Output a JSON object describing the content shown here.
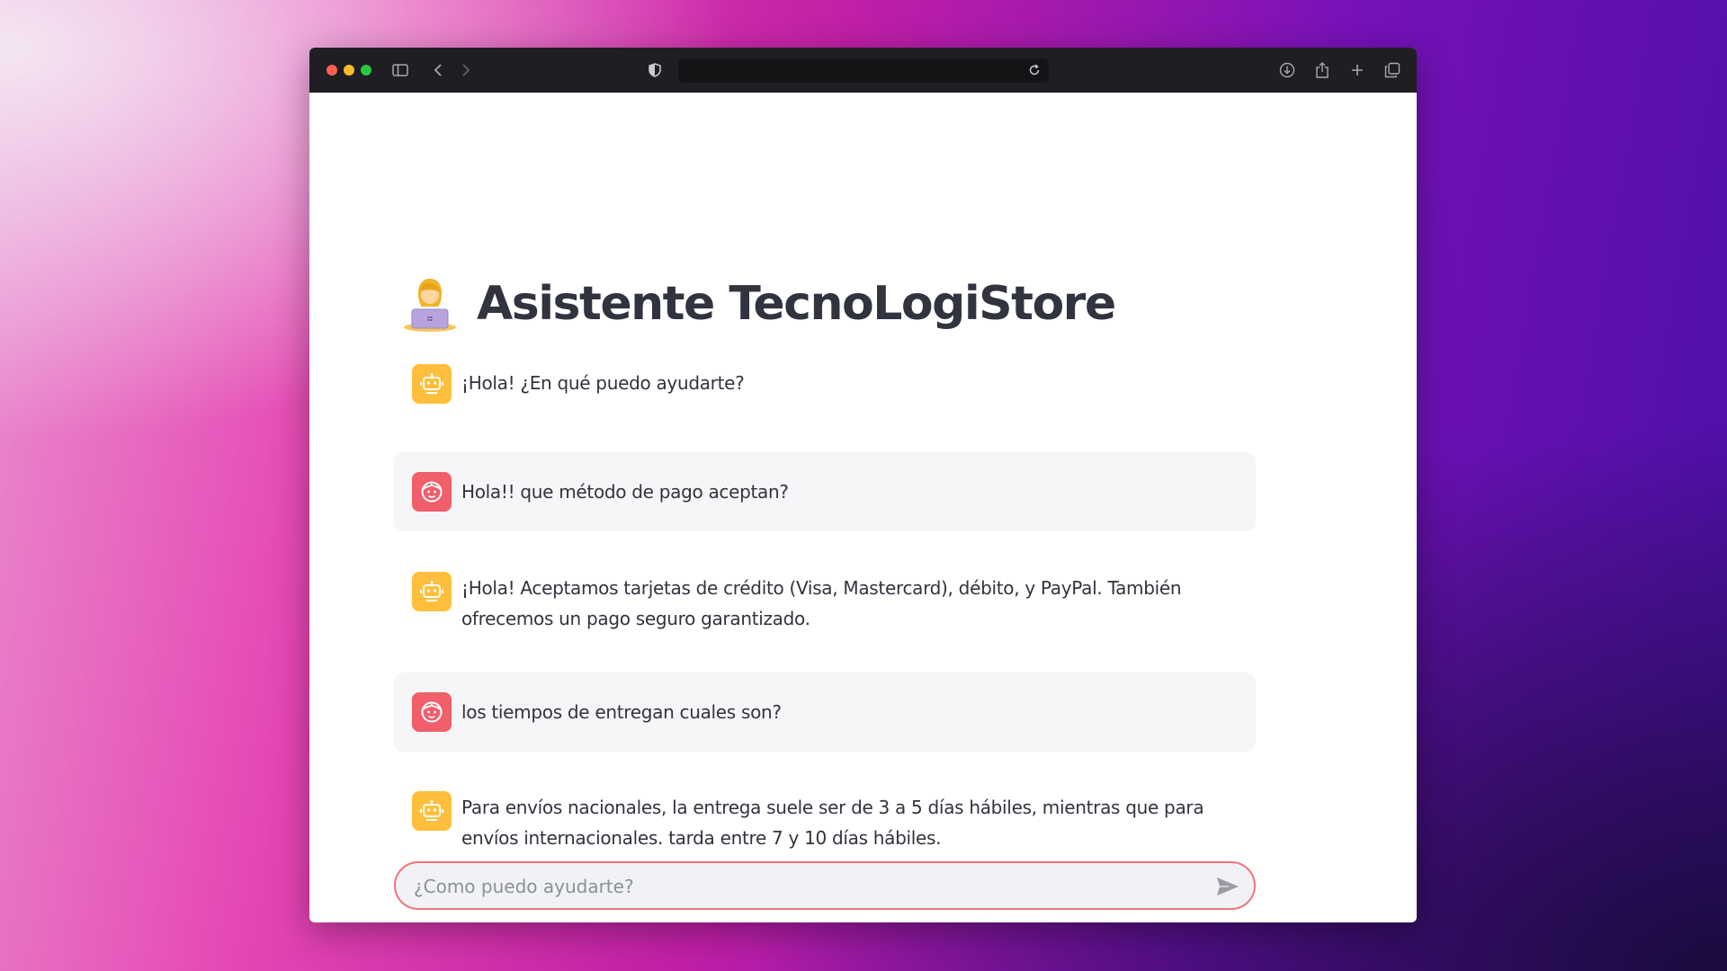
{
  "browser": {
    "traffic_lights": [
      "close",
      "minimize",
      "zoom"
    ],
    "icons": [
      "sidebar-icon",
      "back-icon",
      "forward-icon",
      "privacy-shield-icon",
      "reload-icon",
      "download-icon",
      "share-icon",
      "new-tab-icon",
      "tab-overview-icon"
    ],
    "address": ""
  },
  "page": {
    "title": "Asistente TecnoLogiStore",
    "title_emoji": "technologist-emoji"
  },
  "messages": [
    {
      "role": "assistant",
      "text": "¡Hola! ¿En qué puedo ayudarte?"
    },
    {
      "role": "user",
      "text": "Hola!! que método de pago aceptan?"
    },
    {
      "role": "assistant",
      "text": "¡Hola! Aceptamos tarjetas de crédito (Visa, Mastercard), débito, y PayPal. También ofrecemos un pago seguro garantizado."
    },
    {
      "role": "user",
      "text": "los tiempos de entregan cuales son?"
    },
    {
      "role": "assistant",
      "text": "Para envíos nacionales, la entrega suele ser de 3 a 5 días hábiles, mientras que para envíos internacionales. tarda entre 7 y 10 días hábiles."
    }
  ],
  "chat_input": {
    "placeholder": "¿Como puedo ayudarte?",
    "value": ""
  },
  "colors": {
    "assistant_avatar": "#ffbf3c",
    "user_avatar": "#f05f6a",
    "input_border": "#f0737c",
    "title_text": "#31333f"
  }
}
